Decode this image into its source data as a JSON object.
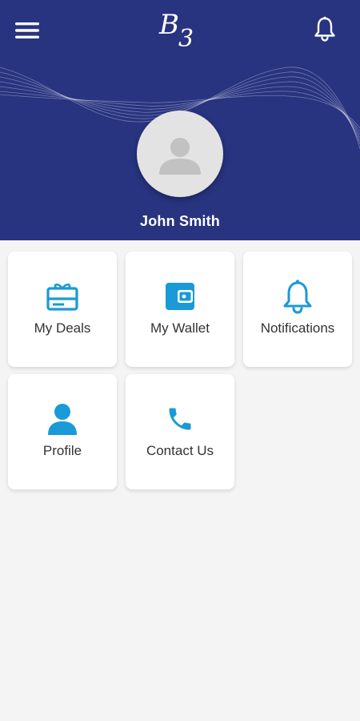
{
  "app": {
    "logo_text": "B3",
    "menu_icon": "hamburger-menu-icon",
    "notification_icon": "bell-icon",
    "brand_color": "#283480",
    "accent_color": "#1a9ad6"
  },
  "profile": {
    "name": "John Smith",
    "avatar_icon": "person-placeholder-icon"
  },
  "tiles": [
    {
      "label": "My Deals",
      "icon": "gift-card-icon"
    },
    {
      "label": "My Wallet",
      "icon": "wallet-icon"
    },
    {
      "label": "Notifications",
      "icon": "bell-icon"
    },
    {
      "label": "Profile",
      "icon": "person-icon"
    },
    {
      "label": "Contact Us",
      "icon": "phone-icon"
    }
  ]
}
